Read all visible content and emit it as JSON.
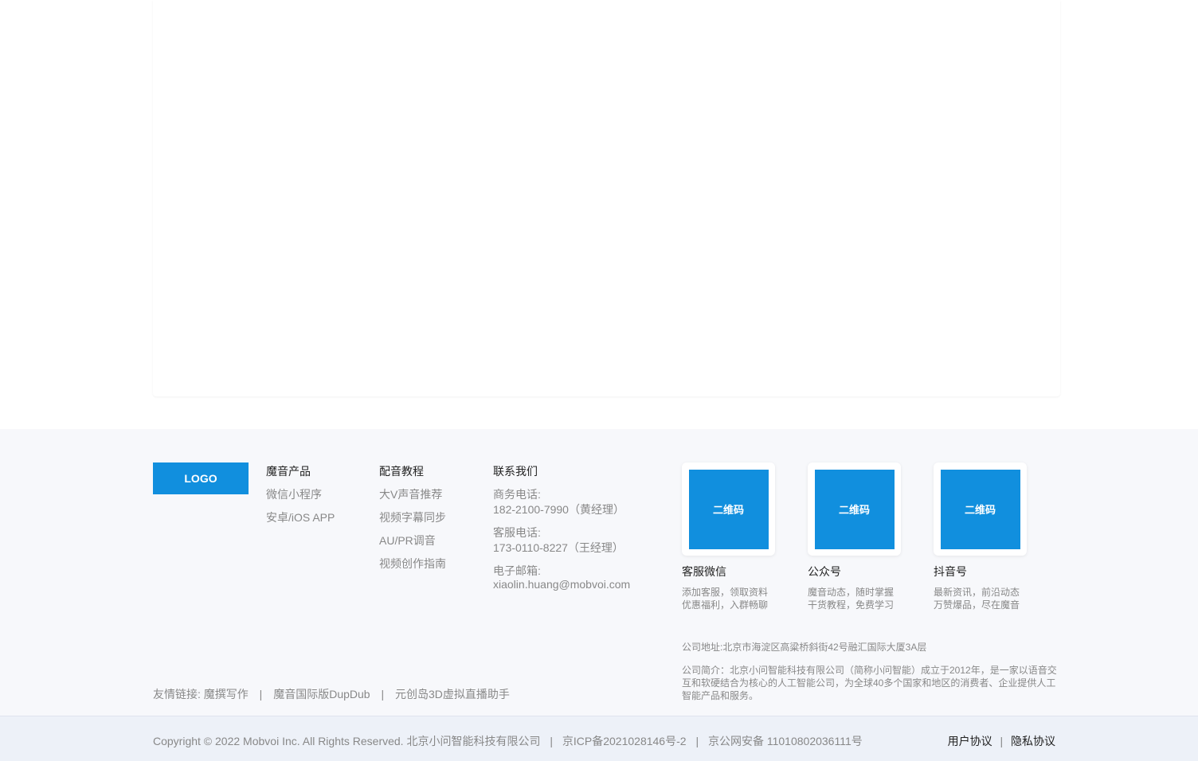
{
  "footer": {
    "logo_text": "LOGO",
    "columns": [
      {
        "title": "魔音产品",
        "items": [
          "微信小程序",
          "安卓/iOS APP"
        ]
      },
      {
        "title": "配音教程",
        "items": [
          "大V声音推荐",
          "视频字幕同步",
          "AU/PR调音",
          "视频创作指南"
        ]
      }
    ],
    "contact": {
      "title": "联系我们",
      "business_label": "商务电话:",
      "business_value": "182-2100-7990（黄经理）",
      "service_label": "客服电话:",
      "service_value": "173-0110-8227（王经理）",
      "email_label": "电子邮箱:",
      "email_value": "xiaolin.huang@mobvoi.com"
    },
    "qr_codes": [
      {
        "placeholder": "二维码",
        "title": "客服微信",
        "desc_line1": "添加客服，领取资料",
        "desc_line2": "优惠福利，入群畅聊"
      },
      {
        "placeholder": "二维码",
        "title": "公众号",
        "desc_line1": "魔音动态，随时掌握",
        "desc_line2": "干货教程，免费学习"
      },
      {
        "placeholder": "二维码",
        "title": "抖音号",
        "desc_line1": "最新资讯，前沿动态",
        "desc_line2": "万赞爆品，尽在魔音"
      }
    ],
    "address": "公司地址:北京市海淀区高粱桥斜街42号融汇国际大厦3A层",
    "intro": "公司简介：北京小问智能科技有限公司（简称小问智能）成立于2012年，是一家以语音交互和软硬结合为核心的人工智能公司，为全球40多个国家和地区的消费者、企业提供人工智能产品和服务。",
    "friend_links": {
      "label": "友情链接:",
      "links": [
        "魔撰写作",
        "魔音国际版DupDub",
        "元创岛3D虚拟直播助手"
      ],
      "separator": "|"
    }
  },
  "bottom_bar": {
    "copyright": "Copyright © 2022 Mobvoi Inc. All Rights Reserved.",
    "company": "北京小问智能科技有限公司",
    "icp": "京ICP备2021028146号-2",
    "police": "京公网安备 11010802036111号",
    "separator": "|",
    "user_agreement": "用户协议",
    "privacy_agreement": "隐私协议"
  },
  "colors": {
    "brand_blue": "#118fde",
    "footer_bg": "#f7f8fb",
    "bottom_bar_bg": "#edf1f8",
    "muted_text": "#888888",
    "dark_text": "#222222"
  }
}
